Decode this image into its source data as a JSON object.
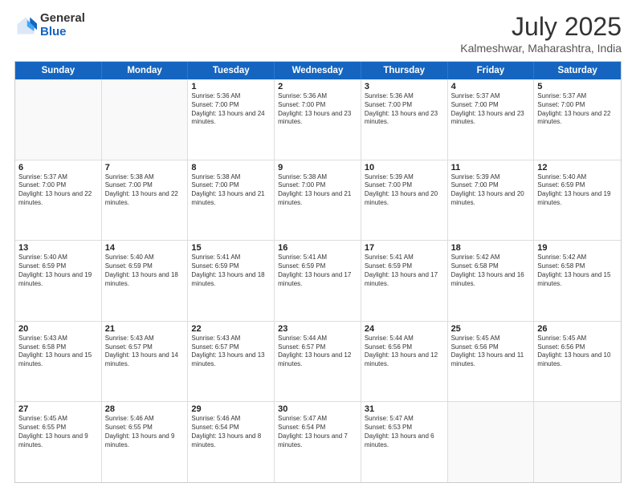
{
  "header": {
    "logo_general": "General",
    "logo_blue": "Blue",
    "month": "July 2025",
    "location": "Kalmeshwar, Maharashtra, India"
  },
  "days_of_week": [
    "Sunday",
    "Monday",
    "Tuesday",
    "Wednesday",
    "Thursday",
    "Friday",
    "Saturday"
  ],
  "weeks": [
    [
      {
        "day": "",
        "empty": true
      },
      {
        "day": "",
        "empty": true
      },
      {
        "day": "1",
        "sunrise": "Sunrise: 5:36 AM",
        "sunset": "Sunset: 7:00 PM",
        "daylight": "Daylight: 13 hours and 24 minutes."
      },
      {
        "day": "2",
        "sunrise": "Sunrise: 5:36 AM",
        "sunset": "Sunset: 7:00 PM",
        "daylight": "Daylight: 13 hours and 23 minutes."
      },
      {
        "day": "3",
        "sunrise": "Sunrise: 5:36 AM",
        "sunset": "Sunset: 7:00 PM",
        "daylight": "Daylight: 13 hours and 23 minutes."
      },
      {
        "day": "4",
        "sunrise": "Sunrise: 5:37 AM",
        "sunset": "Sunset: 7:00 PM",
        "daylight": "Daylight: 13 hours and 23 minutes."
      },
      {
        "day": "5",
        "sunrise": "Sunrise: 5:37 AM",
        "sunset": "Sunset: 7:00 PM",
        "daylight": "Daylight: 13 hours and 22 minutes."
      }
    ],
    [
      {
        "day": "6",
        "sunrise": "Sunrise: 5:37 AM",
        "sunset": "Sunset: 7:00 PM",
        "daylight": "Daylight: 13 hours and 22 minutes."
      },
      {
        "day": "7",
        "sunrise": "Sunrise: 5:38 AM",
        "sunset": "Sunset: 7:00 PM",
        "daylight": "Daylight: 13 hours and 22 minutes."
      },
      {
        "day": "8",
        "sunrise": "Sunrise: 5:38 AM",
        "sunset": "Sunset: 7:00 PM",
        "daylight": "Daylight: 13 hours and 21 minutes."
      },
      {
        "day": "9",
        "sunrise": "Sunrise: 5:38 AM",
        "sunset": "Sunset: 7:00 PM",
        "daylight": "Daylight: 13 hours and 21 minutes."
      },
      {
        "day": "10",
        "sunrise": "Sunrise: 5:39 AM",
        "sunset": "Sunset: 7:00 PM",
        "daylight": "Daylight: 13 hours and 20 minutes."
      },
      {
        "day": "11",
        "sunrise": "Sunrise: 5:39 AM",
        "sunset": "Sunset: 7:00 PM",
        "daylight": "Daylight: 13 hours and 20 minutes."
      },
      {
        "day": "12",
        "sunrise": "Sunrise: 5:40 AM",
        "sunset": "Sunset: 6:59 PM",
        "daylight": "Daylight: 13 hours and 19 minutes."
      }
    ],
    [
      {
        "day": "13",
        "sunrise": "Sunrise: 5:40 AM",
        "sunset": "Sunset: 6:59 PM",
        "daylight": "Daylight: 13 hours and 19 minutes."
      },
      {
        "day": "14",
        "sunrise": "Sunrise: 5:40 AM",
        "sunset": "Sunset: 6:59 PM",
        "daylight": "Daylight: 13 hours and 18 minutes."
      },
      {
        "day": "15",
        "sunrise": "Sunrise: 5:41 AM",
        "sunset": "Sunset: 6:59 PM",
        "daylight": "Daylight: 13 hours and 18 minutes."
      },
      {
        "day": "16",
        "sunrise": "Sunrise: 5:41 AM",
        "sunset": "Sunset: 6:59 PM",
        "daylight": "Daylight: 13 hours and 17 minutes."
      },
      {
        "day": "17",
        "sunrise": "Sunrise: 5:41 AM",
        "sunset": "Sunset: 6:59 PM",
        "daylight": "Daylight: 13 hours and 17 minutes."
      },
      {
        "day": "18",
        "sunrise": "Sunrise: 5:42 AM",
        "sunset": "Sunset: 6:58 PM",
        "daylight": "Daylight: 13 hours and 16 minutes."
      },
      {
        "day": "19",
        "sunrise": "Sunrise: 5:42 AM",
        "sunset": "Sunset: 6:58 PM",
        "daylight": "Daylight: 13 hours and 15 minutes."
      }
    ],
    [
      {
        "day": "20",
        "sunrise": "Sunrise: 5:43 AM",
        "sunset": "Sunset: 6:58 PM",
        "daylight": "Daylight: 13 hours and 15 minutes."
      },
      {
        "day": "21",
        "sunrise": "Sunrise: 5:43 AM",
        "sunset": "Sunset: 6:57 PM",
        "daylight": "Daylight: 13 hours and 14 minutes."
      },
      {
        "day": "22",
        "sunrise": "Sunrise: 5:43 AM",
        "sunset": "Sunset: 6:57 PM",
        "daylight": "Daylight: 13 hours and 13 minutes."
      },
      {
        "day": "23",
        "sunrise": "Sunrise: 5:44 AM",
        "sunset": "Sunset: 6:57 PM",
        "daylight": "Daylight: 13 hours and 12 minutes."
      },
      {
        "day": "24",
        "sunrise": "Sunrise: 5:44 AM",
        "sunset": "Sunset: 6:56 PM",
        "daylight": "Daylight: 13 hours and 12 minutes."
      },
      {
        "day": "25",
        "sunrise": "Sunrise: 5:45 AM",
        "sunset": "Sunset: 6:56 PM",
        "daylight": "Daylight: 13 hours and 11 minutes."
      },
      {
        "day": "26",
        "sunrise": "Sunrise: 5:45 AM",
        "sunset": "Sunset: 6:56 PM",
        "daylight": "Daylight: 13 hours and 10 minutes."
      }
    ],
    [
      {
        "day": "27",
        "sunrise": "Sunrise: 5:45 AM",
        "sunset": "Sunset: 6:55 PM",
        "daylight": "Daylight: 13 hours and 9 minutes."
      },
      {
        "day": "28",
        "sunrise": "Sunrise: 5:46 AM",
        "sunset": "Sunset: 6:55 PM",
        "daylight": "Daylight: 13 hours and 9 minutes."
      },
      {
        "day": "29",
        "sunrise": "Sunrise: 5:46 AM",
        "sunset": "Sunset: 6:54 PM",
        "daylight": "Daylight: 13 hours and 8 minutes."
      },
      {
        "day": "30",
        "sunrise": "Sunrise: 5:47 AM",
        "sunset": "Sunset: 6:54 PM",
        "daylight": "Daylight: 13 hours and 7 minutes."
      },
      {
        "day": "31",
        "sunrise": "Sunrise: 5:47 AM",
        "sunset": "Sunset: 6:53 PM",
        "daylight": "Daylight: 13 hours and 6 minutes."
      },
      {
        "day": "",
        "empty": true
      },
      {
        "day": "",
        "empty": true
      }
    ]
  ]
}
